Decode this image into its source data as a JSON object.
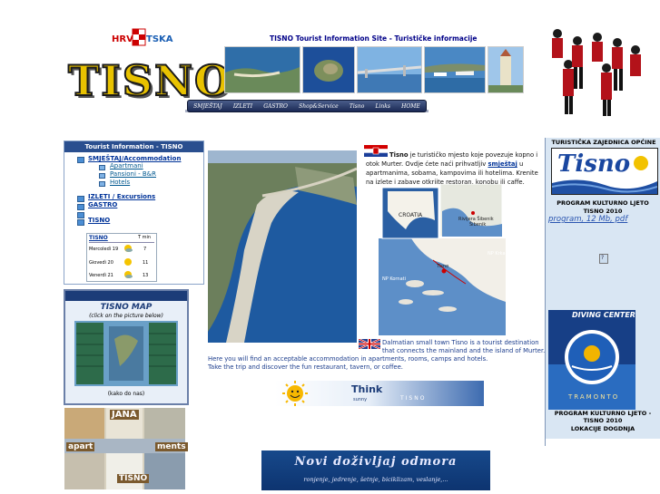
{
  "header": {
    "hrvatska_logo": "HRVATSKA",
    "tisno_logo": "TISNO",
    "site_title": "TISNO Tourist Information Site - Turističke informacije",
    "menu": [
      "SMJEŠTAJ",
      "IZLETI",
      "GASTRO",
      "Shop&Service",
      "Tisno",
      "Links",
      "HOME"
    ]
  },
  "left_panel": {
    "title": "Tourist Information - TISNO",
    "accommodation": "SMJEŠTAJ/Accommodation",
    "sub_items": [
      "Apartmani",
      "Pansioni - B&R",
      "Hotels"
    ],
    "items": [
      "IZLETI / Excursions",
      "GASTRO"
    ],
    "tisno_link": "TISNO",
    "weather": {
      "title": "TISNO",
      "col_header": "T min",
      "rows": [
        {
          "day": "Mercoledì 19",
          "temp": "7",
          "icon": "sun-cloud-icon"
        },
        {
          "day": "Giovedì 20",
          "temp": "11",
          "icon": "sun-icon"
        },
        {
          "day": "Venerdì 21",
          "temp": "13",
          "icon": "sun-cloud-icon"
        }
      ]
    }
  },
  "map_box": {
    "title": "TISNO MAP",
    "subtitle": "(click on the picture below)",
    "caption": "(kako do nas)"
  },
  "jana": {
    "name": "JANA",
    "word1": "apart",
    "word2": "ments",
    "place": "TISNO"
  },
  "center": {
    "hr_text_before": "Tisno",
    "hr_text_1": " je turističko mjesto koje povezuje kopno i otok Murter. Ovdje ćete naći prihvatljiv ",
    "hr_link": "smještaj",
    "hr_text_2": " u apartmanima, sobama, kampovima ili hotelima. Krenite na izlete i zabave otkrijte restoran, konobu ili caffe.",
    "en_text_1": "Dalmatian small town Tisno is a tourist destination that connects the mainland and the island of Murter.",
    "en_text_2": "Here you will find an acceptable accommodation in apartments, rooms, camps and hotels.",
    "en_text_3": "Take the trip and discover the fun restaurant, tavern, or coffee.",
    "think_banner": {
      "big": "Think",
      "small": "sunny",
      "place": "TISNO"
    },
    "map_labels": [
      "CROATIA",
      "Rivijera Šibenik",
      "Šibenik",
      "NP Krka",
      "Tisno",
      "NP Kornati"
    ]
  },
  "bottom_banner": {
    "title": "Novi doživljaj odmora",
    "subtitle": "ronjenje, jedrenje, šetnje, biciklizam, veslanje,..."
  },
  "right_col": {
    "tz_title": "TURISTIČKA ZAJEDNICA OPĆINE",
    "tisno_logo": "Tisno",
    "program_1": "PROGRAM KULTURNO LJETO TISNO 2010",
    "pdf_link": "program, 12 Mb, pdf",
    "broken_icon": "?",
    "diving_title": "DIVING CENTER",
    "diving_name": "TRAMONTO",
    "program_2": "PROGRAM KULTURNO LJETO - TISNO 2010",
    "program_2b": "LOKACIJE DOGDNJA"
  },
  "colors": {
    "nav_blue": "#2a4f8f",
    "link_blue": "#003399",
    "right_bg": "#d9e6f3",
    "logo_gold": "#e8c200"
  }
}
